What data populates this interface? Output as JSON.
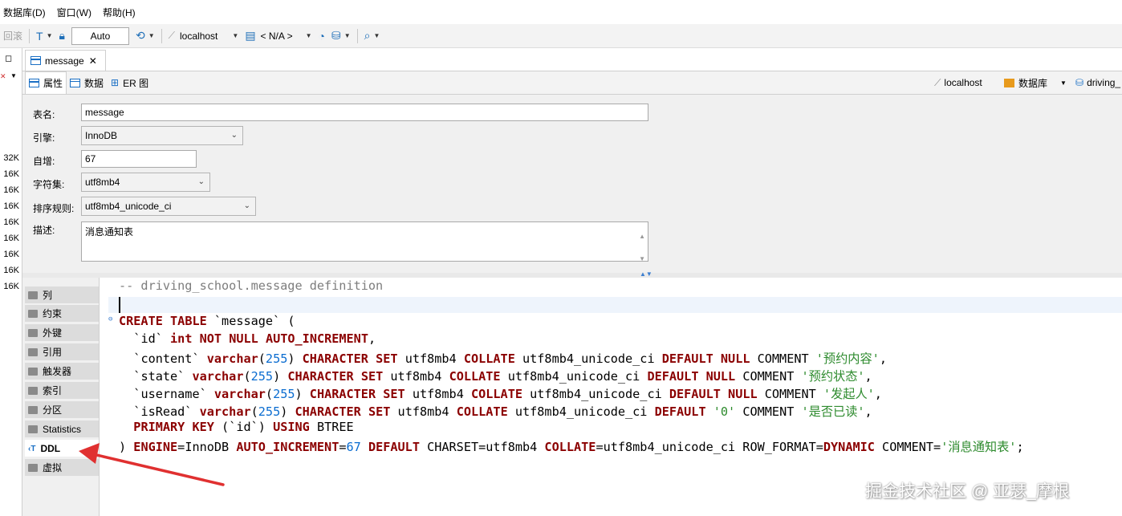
{
  "menubar": {
    "items": [
      "数据库(D)",
      "窗口(W)",
      "帮助(H)"
    ]
  },
  "toolbar": {
    "rollback": "回滚",
    "auto": "Auto",
    "connection": "localhost",
    "schema": "< N/A >"
  },
  "left_strip": {
    "sizes": [
      "32K",
      "16K",
      "16K",
      "16K",
      "16K",
      "16K",
      "16K",
      "16K",
      "16K"
    ]
  },
  "editor_tab": {
    "title": "message"
  },
  "subtabs": {
    "properties": "属性",
    "data": "数据",
    "er": "ER 图"
  },
  "breadcrumb": {
    "connection": "localhost",
    "database": "数据库",
    "schema": "driving_"
  },
  "props": {
    "table_name_label": "表名:",
    "table_name": "message",
    "engine_label": "引擎:",
    "engine": "InnoDB",
    "auto_inc_label": "自增:",
    "auto_inc": "67",
    "charset_label": "字符集:",
    "charset": "utf8mb4",
    "collation_label": "排序规则:",
    "collation": "utf8mb4_unicode_ci",
    "desc_label": "描述:",
    "desc": "消息通知表"
  },
  "side_items": [
    "列",
    "约束",
    "外键",
    "引用",
    "触发器",
    "索引",
    "分区",
    "Statistics",
    "DDL",
    "虚拟"
  ],
  "ddl": {
    "comment_line": "-- driving_school.message definition",
    "table_name": "`message`",
    "col_id": "`id`",
    "col_content": "`content`",
    "col_state": "`state`",
    "col_username": "`username`",
    "col_isread": "`isRead`",
    "comment_content": "'预约内容'",
    "comment_state": "'预约状态'",
    "comment_username": "'发起人'",
    "comment_isread": "'是否已读'",
    "default_isread": "'0'",
    "table_comment": "'消息通知表'",
    "auto_inc": "67",
    "varchar_len": "255"
  },
  "watermark": "掘金技术社区 @ 亚瑟_摩根",
  "colors": {
    "keyword": "#8b0000",
    "number": "#0a6cd0",
    "string": "#2e8b2e",
    "comment": "#7d7d7d",
    "arrow": "#e03030"
  }
}
